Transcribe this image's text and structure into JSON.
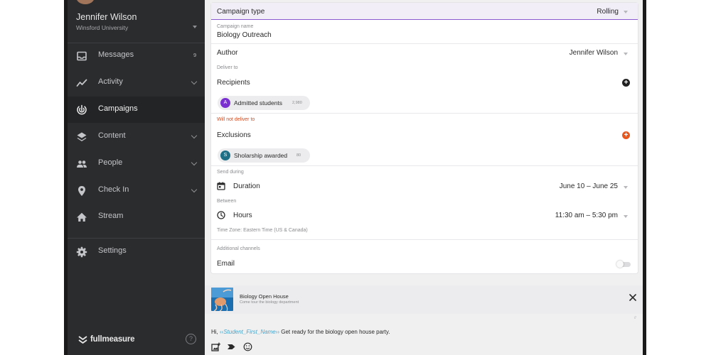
{
  "sidebar": {
    "user_name": "Jennifer Wilson",
    "user_org": "Winsford University",
    "nav": [
      {
        "id": "messages",
        "label": "Messages",
        "icon": "inbox-icon",
        "count": "9"
      },
      {
        "id": "activity",
        "label": "Activity",
        "icon": "activity-icon",
        "expandable": true
      },
      {
        "id": "campaigns",
        "label": "Campaigns",
        "icon": "campaigns-icon",
        "active": true
      },
      {
        "id": "content",
        "label": "Content",
        "icon": "layers-icon",
        "expandable": true
      },
      {
        "id": "people",
        "label": "People",
        "icon": "people-icon",
        "expandable": true
      },
      {
        "id": "checkin",
        "label": "Check In",
        "icon": "location-pin-icon",
        "expandable": true
      },
      {
        "id": "stream",
        "label": "Stream",
        "icon": "home-icon"
      },
      {
        "id": "settings",
        "label": "Settings",
        "icon": "gear-icon"
      }
    ],
    "logo_text": "fullmeasure",
    "help": "?"
  },
  "form": {
    "campaign_type_label": "Campaign type",
    "campaign_type_value": "Rolling",
    "campaign_name_label": "Campaign name",
    "campaign_name_value": "Biology Outreach",
    "author_label": "Author",
    "author_value": "Jennifer Wilson",
    "deliver_to_label": "Deliver to",
    "recipients_label": "Recipients",
    "recipient_chip": {
      "initial": "A",
      "label": "Admitted students",
      "count": "2,980",
      "color": "#7a2fd0"
    },
    "will_not_deliver_label": "Will not deliver to",
    "exclusions_label": "Exclusions",
    "exclusion_chip": {
      "initial": "S",
      "label": "Sholarship awarded",
      "count": "80",
      "color": "#1f6f86"
    },
    "send_during_label": "Send during",
    "duration_label": "Duration",
    "duration_value": "June 10 – June 25",
    "between_label": "Between",
    "hours_label": "Hours",
    "hours_value": "11:30 am – 5:30 pm",
    "timezone_text": "Time Zone: Eastern Time (US & Canada)",
    "additional_channels_label": "Additional channels",
    "email_label": "Email",
    "email_enabled": false
  },
  "preview": {
    "title": "Biology Open House",
    "subtitle": "Come tour the biology department"
  },
  "composer": {
    "prefix": "Hi, ",
    "merge_field": "Student_First_Name",
    "suffix": " Get ready for the biology open house party."
  },
  "colors": {
    "sidebar_bg": "#2b2c2e",
    "accent_purple": "#8a5bd0",
    "exclusion_orange": "#e8571e",
    "merge_blue": "#4aa3c8"
  }
}
